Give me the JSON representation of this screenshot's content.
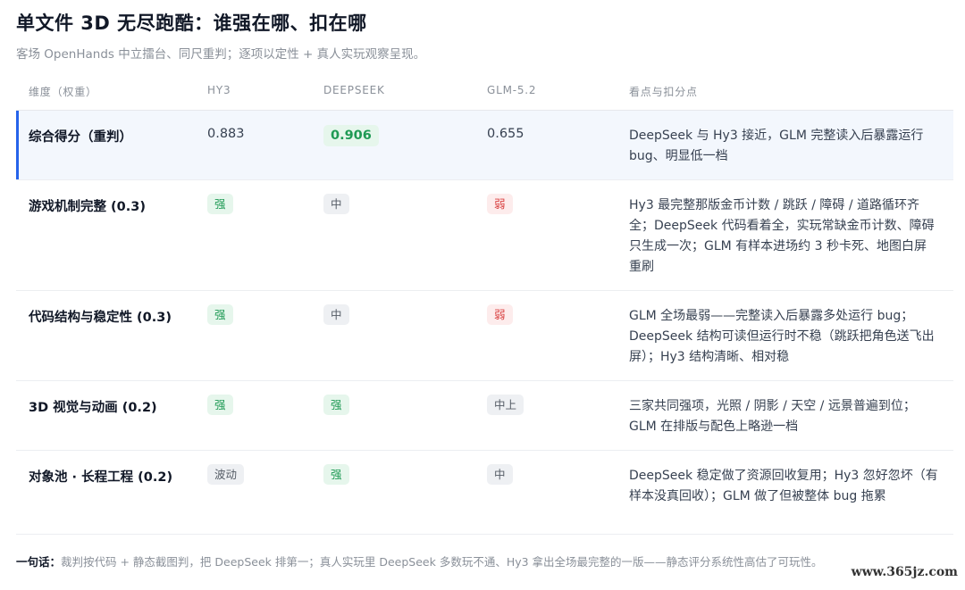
{
  "title": "单文件 3D 无尽跑酷：谁强在哪、扣在哪",
  "subtitle": "客场 OpenHands 中立擂台、同尺重判；逐项以定性 + 真人实玩观察呈现。",
  "columns": [
    "维度（权重）",
    "HY3",
    "DEEPSEEK",
    "GLM-5.2",
    "看点与扣分点"
  ],
  "rows": [
    {
      "dimension": "综合得分（重判）",
      "hy3": "0.883",
      "deepseek": "0.906",
      "glm": "0.655",
      "note": "DeepSeek 与 Hy3 接近，GLM 完整读入后暴露运行 bug、明显低一档"
    },
    {
      "dimension": "游戏机制完整 (0.3)",
      "hy3": "强",
      "deepseek": "中",
      "glm": "弱",
      "note": "Hy3 最完整那版金币计数 / 跳跃 / 障碍 / 道路循环齐全；DeepSeek 代码看着全，实玩常缺金币计数、障碍只生成一次；GLM 有样本进场约 3 秒卡死、地图白屏重刷"
    },
    {
      "dimension": "代码结构与稳定性 (0.3)",
      "hy3": "强",
      "deepseek": "中",
      "glm": "弱",
      "note": "GLM 全场最弱——完整读入后暴露多处运行 bug；DeepSeek 结构可读但运行时不稳（跳跃把角色送飞出屏）；Hy3 结构清晰、相对稳"
    },
    {
      "dimension": "3D 视觉与动画 (0.2)",
      "hy3": "强",
      "deepseek": "强",
      "glm": "中上",
      "note": "三家共同强项，光照 / 阴影 / 天空 / 远景普遍到位；GLM 在排版与配色上略逊一档"
    },
    {
      "dimension": "对象池 · 长程工程 (0.2)",
      "hy3": "波动",
      "deepseek": "强",
      "glm": "中",
      "note": "DeepSeek 稳定做了资源回收复用；Hy3 忽好忽坏（有样本没真回收）；GLM 做了但被整体 bug 拖累"
    }
  ],
  "summary_label": "一句话：",
  "summary_text": "裁判按代码 + 静态截图判，把 DeepSeek 排第一；真人实玩里 DeepSeek 多数玩不通、Hy3 拿出全场最完整的一版——静态评分系统性高估了可玩性。",
  "watermark": "www.365jz.com",
  "colors": {
    "accent": "#2563eb",
    "strong": "#1f9a55",
    "weak": "#d94141",
    "highlight_bg": "#f3f7fd"
  }
}
